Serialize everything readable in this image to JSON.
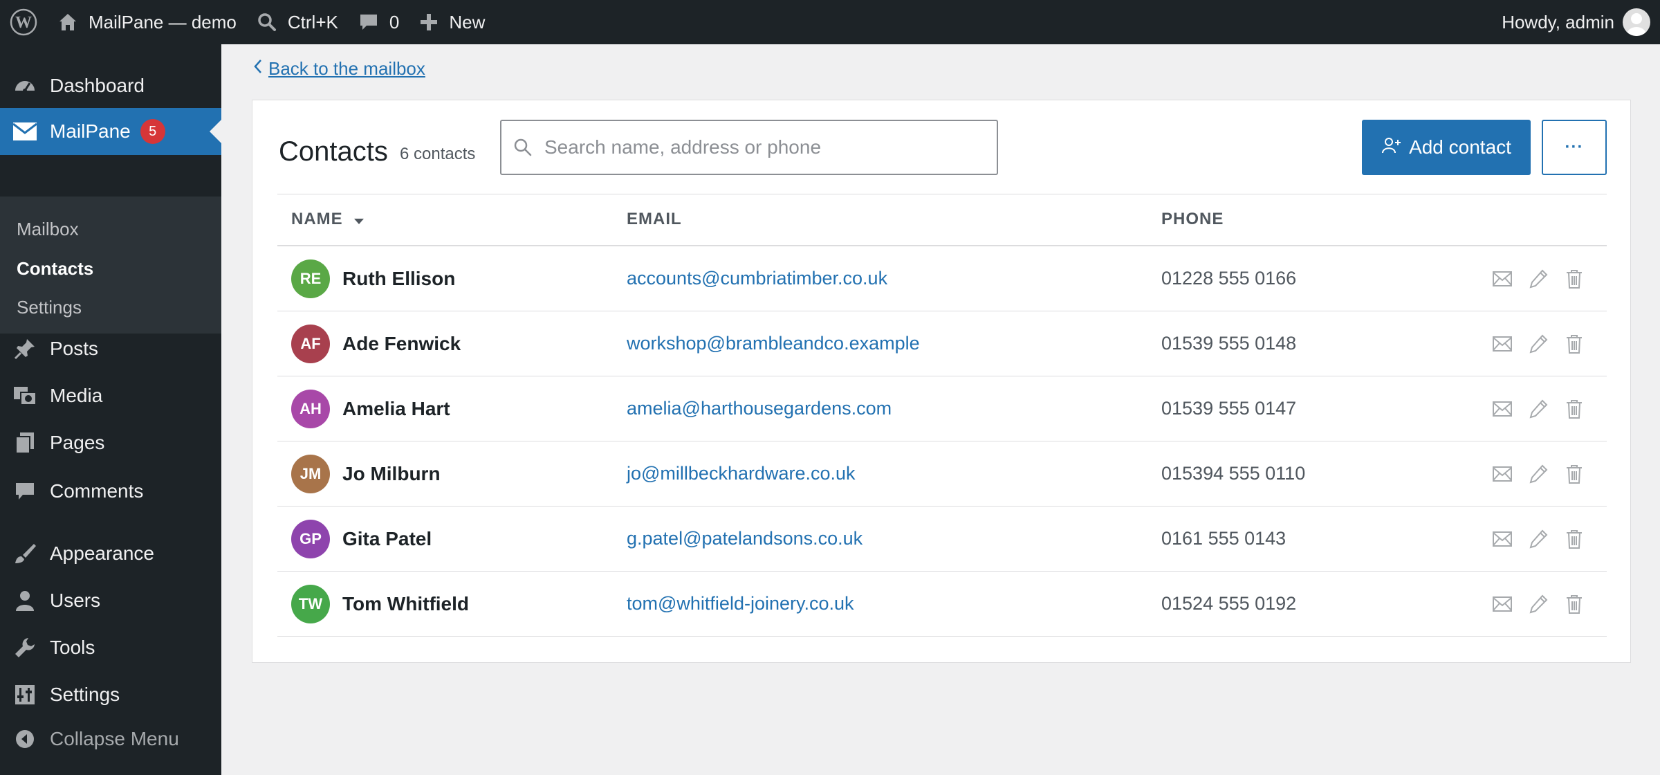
{
  "adminbar": {
    "site_name": "MailPane — demo",
    "search_shortcut": "Ctrl+K",
    "comments_count": "0",
    "new_label": "New",
    "greeting": "Howdy, admin"
  },
  "sidebar": {
    "dashboard": "Dashboard",
    "mailpane": "MailPane",
    "mailpane_badge": "5",
    "submenu": [
      "Mailbox",
      "Contacts",
      "Settings"
    ],
    "posts": "Posts",
    "media": "Media",
    "pages": "Pages",
    "comments": "Comments",
    "appearance": "Appearance",
    "users": "Users",
    "tools": "Tools",
    "settings": "Settings",
    "collapse": "Collapse Menu"
  },
  "main": {
    "back_link": "Back to the mailbox",
    "title": "Contacts",
    "count": "6 contacts",
    "search_placeholder": "Search name, address or phone",
    "add_button": "Add contact",
    "more_button": "···",
    "columns": {
      "name": "NAME",
      "email": "EMAIL",
      "phone": "PHONE"
    },
    "contacts": [
      {
        "initials": "RE",
        "name": "Ruth Ellison",
        "email": "accounts@cumbriatimber.co.uk",
        "phone": "01228 555 0166",
        "color": "#5aa846"
      },
      {
        "initials": "AF",
        "name": "Ade Fenwick",
        "email": "workshop@brambleandco.example",
        "phone": "01539 555 0148",
        "color": "#a8404e"
      },
      {
        "initials": "AH",
        "name": "Amelia Hart",
        "email": "amelia@harthousegardens.com",
        "phone": "01539 555 0147",
        "color": "#a848a8"
      },
      {
        "initials": "JM",
        "name": "Jo Milburn",
        "email": "jo@millbeckhardware.co.uk",
        "phone": "015394 555 0110",
        "color": "#a8744a"
      },
      {
        "initials": "GP",
        "name": "Gita Patel",
        "email": "g.patel@patelandsons.co.uk",
        "phone": "0161 555 0143",
        "color": "#8e44ad"
      },
      {
        "initials": "TW",
        "name": "Tom Whitfield",
        "email": "tom@whitfield-joinery.co.uk",
        "phone": "01524 555 0192",
        "color": "#46a84a"
      }
    ]
  },
  "colors": {
    "admin_dark": "#1d2327",
    "accent": "#2271b1",
    "badge": "#d63638"
  },
  "icons": {
    "row_actions": [
      "envelope-icon",
      "pencil-icon",
      "trash-icon"
    ]
  }
}
